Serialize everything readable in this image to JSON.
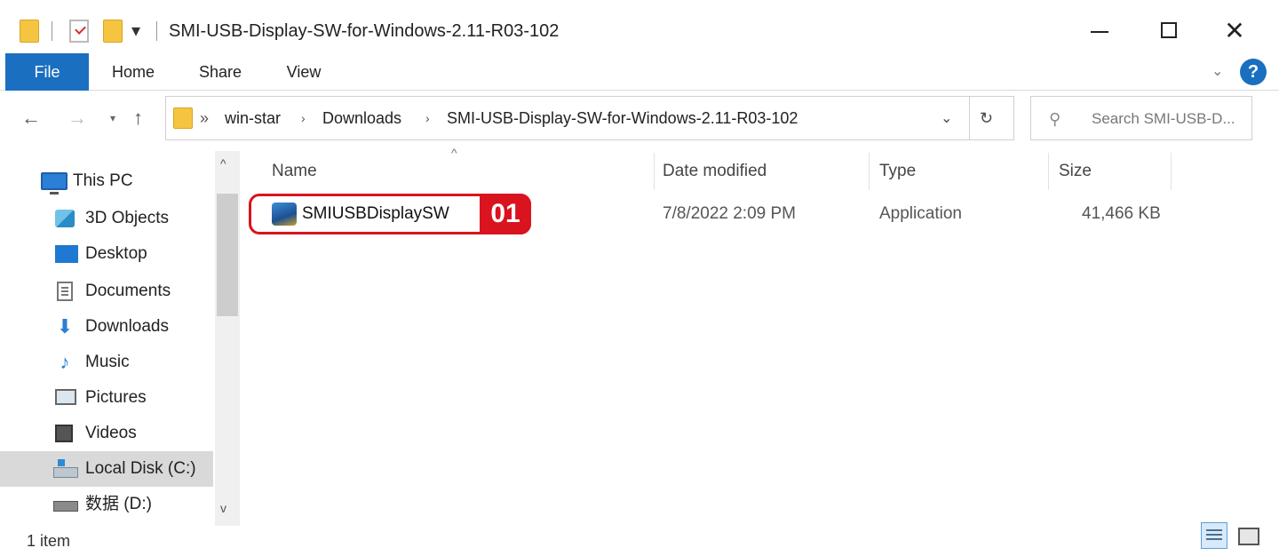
{
  "window": {
    "title": "SMI-USB-Display-SW-for-Windows-2.11-R03-102",
    "qa_dropdown": "▾",
    "minimize": "",
    "maximize": "",
    "close": "✕"
  },
  "ribbon": {
    "tabs": [
      {
        "label": "File",
        "active": true
      },
      {
        "label": "Home"
      },
      {
        "label": "Share"
      },
      {
        "label": "View"
      }
    ],
    "expand_icon": "chevron-down-icon",
    "help": "?"
  },
  "nav": {
    "back": "←",
    "forward": "→",
    "recent": "▾",
    "up": "↑"
  },
  "address": {
    "prefix": "»",
    "crumbs": [
      "win-star",
      "Downloads",
      "SMI-USB-Display-SW-for-Windows-2.11-R03-102"
    ],
    "separator": "›",
    "dropdown": "⌄",
    "refresh": "↻"
  },
  "search": {
    "placeholder": "Search SMI-USB-D..."
  },
  "sidebar": {
    "items": [
      {
        "label": "This PC",
        "icon": "computer-icon"
      },
      {
        "label": "3D Objects",
        "icon": "cube-icon"
      },
      {
        "label": "Desktop",
        "icon": "desktop-icon"
      },
      {
        "label": "Documents",
        "icon": "document-icon"
      },
      {
        "label": "Downloads",
        "icon": "download-arrow-icon"
      },
      {
        "label": "Music",
        "icon": "music-note-icon"
      },
      {
        "label": "Pictures",
        "icon": "picture-icon"
      },
      {
        "label": "Videos",
        "icon": "film-icon"
      },
      {
        "label": "Local Disk (C:)",
        "icon": "drive-icon",
        "selected": true
      },
      {
        "label": "数据 (D:)",
        "icon": "drive-icon"
      }
    ],
    "scroll_up": "^",
    "scroll_down": "v"
  },
  "filelist": {
    "columns": [
      "Name",
      "Date modified",
      "Type",
      "Size"
    ],
    "sort_indicator": "^",
    "rows": [
      {
        "name": "SMIUSBDisplaySW",
        "date": "7/8/2022 2:09 PM",
        "type": "Application",
        "size": "41,466 KB",
        "icon": "installer-icon"
      }
    ]
  },
  "annotation": {
    "badge": "01",
    "color": "#d9141e"
  },
  "status": {
    "count": "1 item"
  },
  "colors": {
    "accent": "#1a6fc0",
    "selected_bg": "#d9d9d9"
  }
}
